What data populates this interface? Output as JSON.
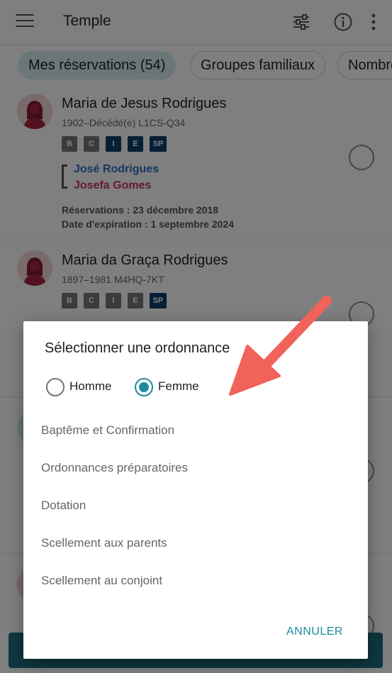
{
  "appbar": {
    "title": "Temple"
  },
  "chips": [
    "Mes réservations (54)",
    "Groupes familiaux",
    "Nombre"
  ],
  "items": [
    {
      "name": "Maria de Jesus Rodrigues",
      "meta": "1902–Décédé(e)   L1CS-Q34",
      "badges": [
        "B",
        "C",
        "I",
        "E",
        "SP"
      ],
      "father": "José Rodrigues",
      "mother": "Josefa Gomes",
      "reserved": "Réservations : 23 décembre 2018",
      "expires": "Date d'expiration : 1 septembre 2024"
    },
    {
      "name": "Maria da Graça Rodrigues",
      "meta": "1897–1981   M4HQ-7KT",
      "badges": [
        "B",
        "C",
        "I",
        "E",
        "SP"
      ]
    }
  ],
  "dialog": {
    "title": "Sélectionner une ordonnance",
    "gender_options": [
      "Homme",
      "Femme"
    ],
    "selected_gender": "Femme",
    "ordinances": [
      "Baptême et Confirmation",
      "Ordonnances préparatoires",
      "Dotation",
      "Scellement aux parents",
      "Scellement au conjoint"
    ],
    "cancel_label": "ANNULER"
  },
  "colors": {
    "accent": "#1b8aa1",
    "chip_active": "#d5ecef",
    "father_link": "#2b6fc4",
    "mother_link": "#c8385a",
    "ordinance_done": "#0f3d6e",
    "annotation_arrow": "#f0625a"
  }
}
